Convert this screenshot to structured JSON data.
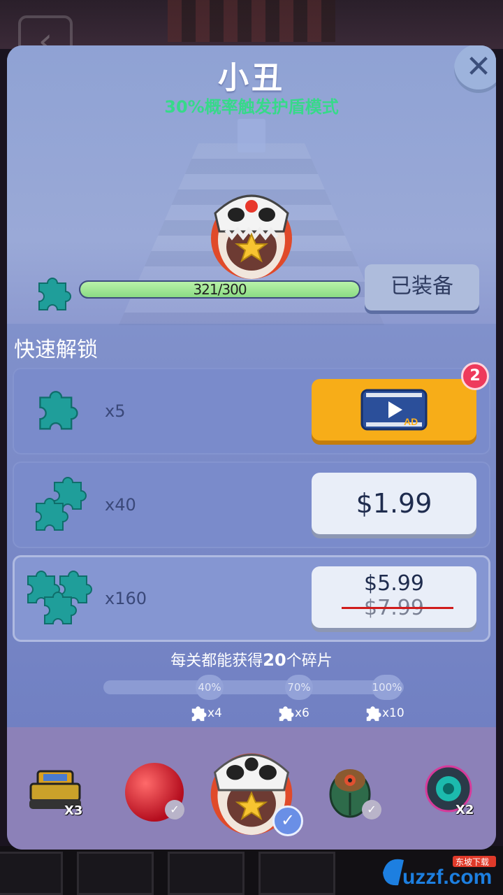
{
  "character": {
    "name": "小丑",
    "ability": "30%概率触发护盾模式"
  },
  "progress": {
    "text": "321/300",
    "current": 321,
    "target": 300,
    "fill_fraction": 1.0
  },
  "equip_button": "已装备",
  "quick_unlock": {
    "title": "快速解锁",
    "rows": [
      {
        "qty": "x5",
        "action": "ad",
        "ad_label": "AD",
        "badge": "2"
      },
      {
        "qty": "x40",
        "price": "$1.99"
      },
      {
        "qty": "x160",
        "price": "$5.99",
        "old_price": "$7.99"
      }
    ]
  },
  "level_reward": {
    "prefix": "每关都能获得",
    "amount": "20",
    "suffix": "个碎片",
    "milestones": [
      {
        "label": "40%",
        "reward": "x4"
      },
      {
        "label": "70%",
        "reward": "x6"
      },
      {
        "label": "100%",
        "reward": "x10"
      }
    ]
  },
  "selector": {
    "items": [
      {
        "name": "tank",
        "multiplier": "X3"
      },
      {
        "name": "red-ball"
      },
      {
        "name": "clown-ball",
        "selected": true
      },
      {
        "name": "scarab"
      },
      {
        "name": "cyber-ball",
        "multiplier": "X2"
      }
    ]
  },
  "watermark": {
    "text": "uzzf.com",
    "tag": "东坡下载"
  },
  "colors": {
    "accent_green": "#37d98a",
    "ad_button": "#f7ad18",
    "badge": "#ee3a5c",
    "panel": "#7f8fca"
  }
}
